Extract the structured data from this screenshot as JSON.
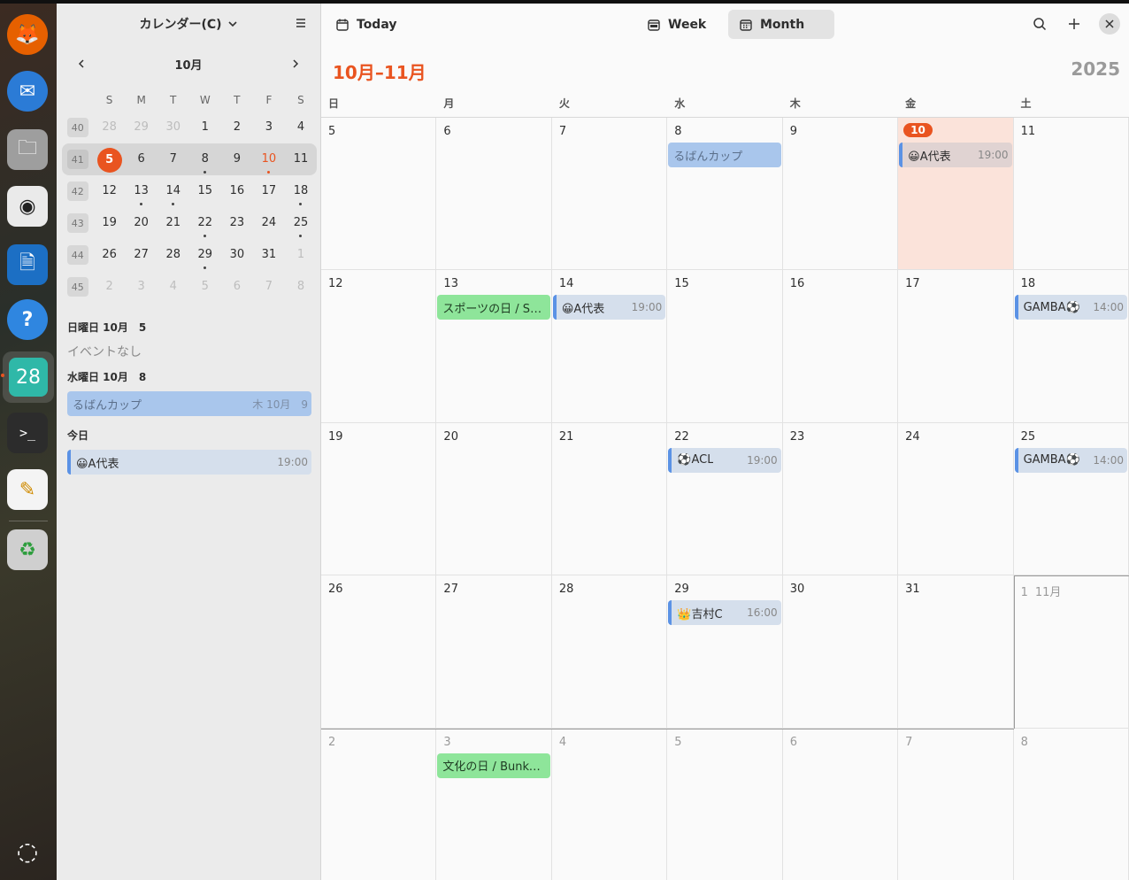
{
  "colors": {
    "accent": "#e95420",
    "event_green": "#8ee59a",
    "event_blue": "#a9c6ec",
    "event_blue_bar": "#5b92e5",
    "today_cell": "#fbe3da"
  },
  "dock": {
    "items": [
      {
        "name": "firefox-icon",
        "glyph": "🦊"
      },
      {
        "name": "thunderbird-icon",
        "glyph": "✉"
      },
      {
        "name": "files-icon",
        "glyph": "🗀"
      },
      {
        "name": "rhythmbox-icon",
        "glyph": "◉"
      },
      {
        "name": "writer-icon",
        "glyph": "🗎"
      },
      {
        "name": "help-icon",
        "glyph": "?"
      },
      {
        "name": "calendar-icon",
        "glyph": "28"
      },
      {
        "name": "terminal-icon",
        "glyph": ">_"
      },
      {
        "name": "text-editor-icon",
        "glyph": "✎"
      },
      {
        "name": "trash-icon",
        "glyph": "♻"
      },
      {
        "name": "show-apps-icon",
        "glyph": "◌"
      }
    ]
  },
  "sidebar": {
    "title": "カレンダー(C)",
    "mini": {
      "month": "10月",
      "dow": [
        "S",
        "M",
        "T",
        "W",
        "T",
        "F",
        "S"
      ],
      "weeks": [
        {
          "wk": "40",
          "days": [
            "28",
            "29",
            "30",
            "1",
            "2",
            "3",
            "4"
          ]
        },
        {
          "wk": "41",
          "days": [
            "5",
            "6",
            "7",
            "8",
            "9",
            "10",
            "11"
          ]
        },
        {
          "wk": "42",
          "days": [
            "12",
            "13",
            "14",
            "15",
            "16",
            "17",
            "18"
          ]
        },
        {
          "wk": "43",
          "days": [
            "19",
            "20",
            "21",
            "22",
            "23",
            "24",
            "25"
          ]
        },
        {
          "wk": "44",
          "days": [
            "26",
            "27",
            "28",
            "29",
            "30",
            "31",
            "1"
          ]
        },
        {
          "wk": "45",
          "days": [
            "2",
            "3",
            "4",
            "5",
            "6",
            "7",
            "8"
          ]
        }
      ]
    },
    "agenda": {
      "h1": "日曜日 10月　5",
      "none": "イベントなし",
      "h2": "水曜日 10月　8",
      "ev1_title": "るばんカップ",
      "ev1_time": "木 10月　9",
      "h3": "今日",
      "ev2_title": "😀A代表",
      "ev2_time": "19:00"
    }
  },
  "toolbar": {
    "today": "Today",
    "week": "Week",
    "month": "Month"
  },
  "header": {
    "range": "10月–11月",
    "year": "2025"
  },
  "month_view": {
    "dow": [
      "日",
      "月",
      "火",
      "水",
      "木",
      "金",
      "土"
    ],
    "weeks": [
      [
        "5",
        "6",
        "7",
        "8",
        "9",
        "10",
        "11"
      ],
      [
        "12",
        "13",
        "14",
        "15",
        "16",
        "17",
        "18"
      ],
      [
        "19",
        "20",
        "21",
        "22",
        "23",
        "24",
        "25"
      ],
      [
        "26",
        "27",
        "28",
        "29",
        "30",
        "31",
        "1"
      ],
      [
        "2",
        "3",
        "4",
        "5",
        "6",
        "7",
        "8"
      ]
    ],
    "nov_label": "11月",
    "events": [
      {
        "title": "るばんカップ",
        "time": ""
      },
      {
        "title": "😀A代表",
        "time": "19:00"
      },
      {
        "title": "スポーツの日 / Sports Day",
        "time": ""
      },
      {
        "title": "😀A代表",
        "time": "19:00"
      },
      {
        "title": "GAMBA⚽",
        "time": "14:00"
      },
      {
        "title": "⚽ACL",
        "time": "19:00"
      },
      {
        "title": "GAMBA⚽",
        "time": "14:00"
      },
      {
        "title": "👑吉村C",
        "time": "16:00"
      },
      {
        "title": "文化の日 / Bunka no Hi",
        "time": ""
      }
    ]
  }
}
